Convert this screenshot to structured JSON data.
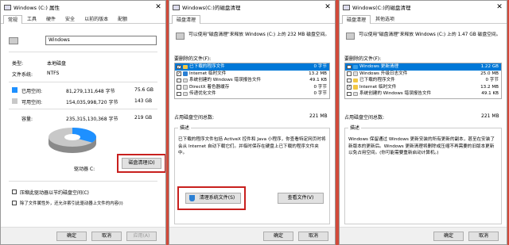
{
  "w1": {
    "title": "Windows (C:) 属性",
    "close": "✕",
    "tabs": [
      "常规",
      "工具",
      "硬件",
      "安全",
      "以前的版本",
      "配额"
    ],
    "name_value": "Windows",
    "type_label": "类型:",
    "type_value": "本地磁盘",
    "fs_label": "文件系统:",
    "fs_value": "NTFS",
    "used_label": "已用空间:",
    "used_bytes": "81,279,131,648 字节",
    "used_gb": "75.6 GB",
    "free_label": "可用空间:",
    "free_bytes": "154,035,998,720 字节",
    "free_gb": "143 GB",
    "cap_label": "容量:",
    "cap_bytes": "235,315,130,368 字节",
    "cap_gb": "219 GB",
    "drive_label": "驱动器 C:",
    "cleanup_btn": "磁盘清理(D)",
    "compress_label": "压缩此驱动器以节约磁盘空间(C)",
    "index_label": "除了文件属性外，还允许索引此驱动器上文件的内容(I)",
    "ok": "确定",
    "cancel": "取消",
    "apply": "应用(A)",
    "used_color": "#1e90ff",
    "free_color": "#c8c8c8",
    "used_fraction": 0.345
  },
  "w2": {
    "title": "Windows(C:)的磁盘清理",
    "close": "✕",
    "tabs": [
      "磁盘清理"
    ],
    "intro": "可以使用\"磁盘清理\"来释放 Windows (C:) 上的 232 MB 磁盘空间。",
    "files_label": "要删除的文件(F):",
    "rows": [
      {
        "checked": "✓",
        "name": "已下载的程序文件",
        "size": "0 字节",
        "selected": true
      },
      {
        "checked": "✓",
        "name": "Internet 临时文件",
        "size": "13.2 MB",
        "selected": false
      },
      {
        "checked": "",
        "name": "系统创建的 Windows 错误报告文件",
        "size": "49.1 KB",
        "selected": false
      },
      {
        "checked": "",
        "name": "DirectX 着色器缓存",
        "size": "0 字节",
        "selected": false
      },
      {
        "checked": "",
        "name": "传递优化文件",
        "size": "0 字节",
        "selected": false
      }
    ],
    "total_label": "占用磁盘空间总数:",
    "total_value": "221 MB",
    "desc_label": "描述",
    "desc_text": "已下载的程序文件包括 ActiveX 控件和 Java 小程序，你查看特定网页时将会从 Internet 自动下载它们。并临时保存在硬盘上已下载的程序文件夹中。",
    "sysclean_btn": "清理系统文件(S)",
    "viewfiles_btn": "查看文件(V)",
    "ok": "确定",
    "cancel": "取消"
  },
  "w3": {
    "title": "Windows(C:)的磁盘清理",
    "close": "✕",
    "tabs": [
      "磁盘清理",
      "其他选项"
    ],
    "intro": "可以使用\"磁盘清理\"来释放 Windows (C:) 上的 1.47 GB 磁盘空间。",
    "files_label": "要删除的文件(F):",
    "rows": [
      {
        "checked": "",
        "name": "Windows 更新清理",
        "size": "1.22 GB",
        "selected": true
      },
      {
        "checked": "",
        "name": "Windows 升级日志文件",
        "size": "25.0 MB",
        "selected": false
      },
      {
        "checked": "",
        "name": "已下载的程序文件",
        "size": "0 字节",
        "selected": false
      },
      {
        "checked": "✓",
        "name": "Internet 临时文件",
        "size": "13.2 MB",
        "selected": false
      },
      {
        "checked": "",
        "name": "系统创建的 Windows 错误报告文件",
        "size": "49.1 KB",
        "selected": false
      }
    ],
    "total_label": "占用磁盘空间总数:",
    "total_value": "221 MB",
    "desc_label": "描述",
    "desc_text": "Windows 保留通过 Windows 更新安装的所有更新的副本，甚至在安装了新版本的更新后。Windows 更新清理将删除或压缩不再需要的旧版本更新以免占用空间。(你可能需要重新启动计算机。)",
    "ok": "确定",
    "cancel": "取消"
  }
}
